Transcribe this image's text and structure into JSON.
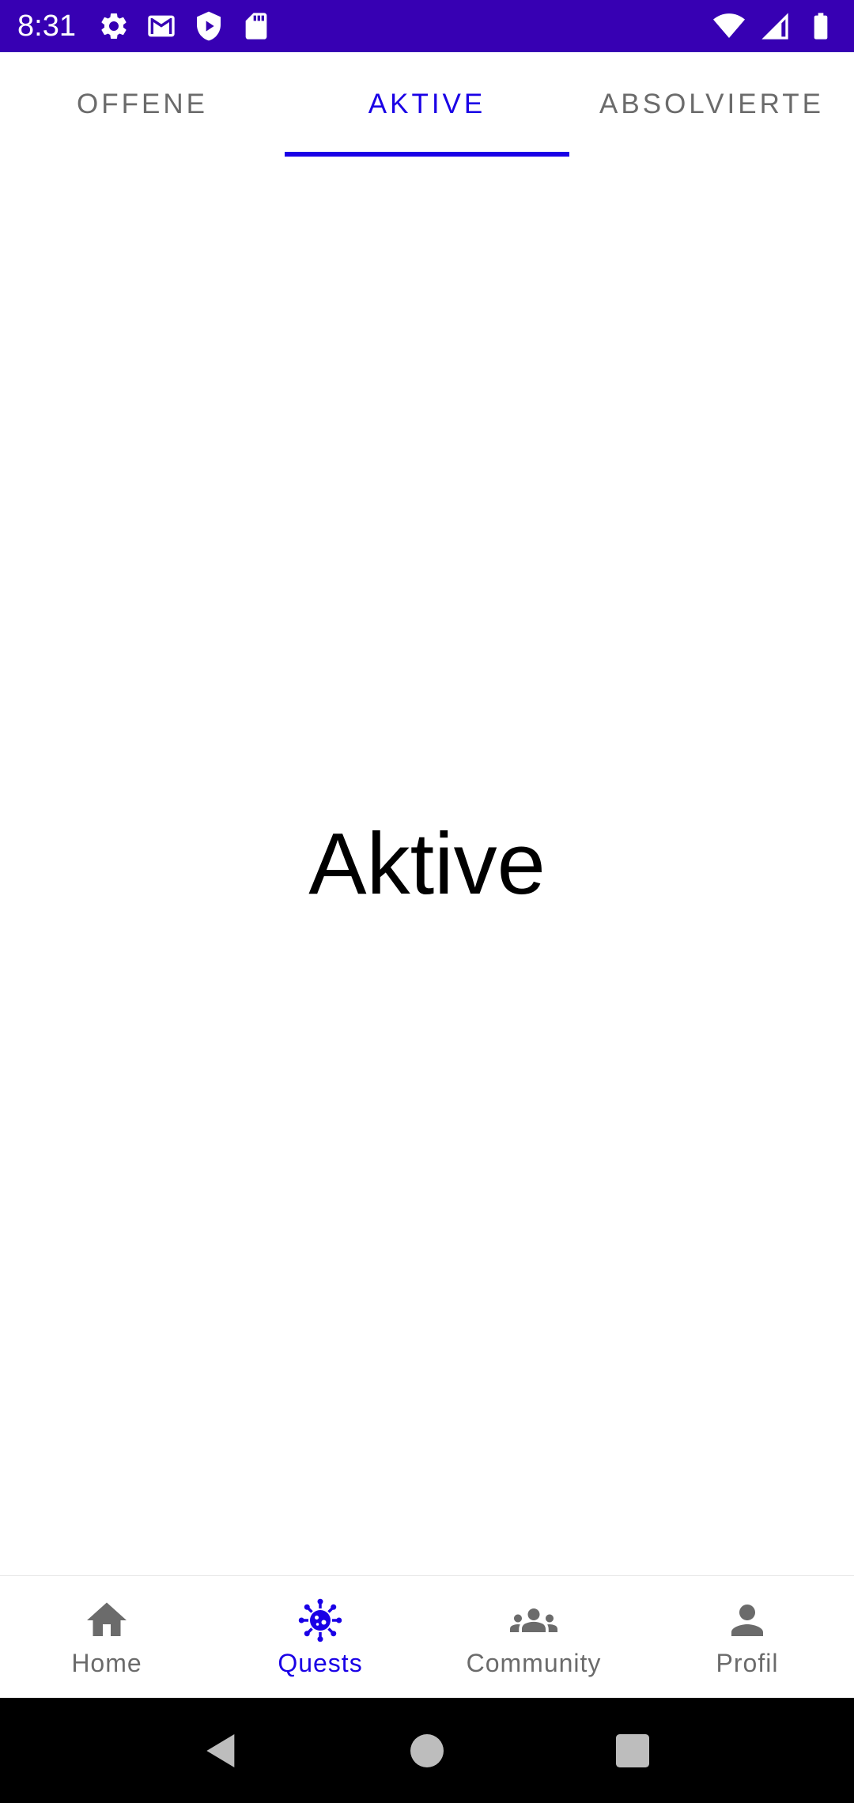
{
  "status_bar": {
    "time": "8:31",
    "left_icons": [
      "settings-icon",
      "gmail-icon",
      "shield-play-icon",
      "sd-card-icon"
    ],
    "right_icons": [
      "wifi-icon",
      "signal-icon",
      "battery-icon"
    ],
    "background": "#3700b3"
  },
  "tabs": [
    {
      "label": "OFFENE",
      "active": false
    },
    {
      "label": "AKTIVE",
      "active": true
    },
    {
      "label": "ABSOLVIERTE",
      "active": false
    }
  ],
  "main": {
    "title": "Aktive"
  },
  "bottom_nav": [
    {
      "label": "Home",
      "icon": "home-icon",
      "active": false
    },
    {
      "label": "Quests",
      "icon": "virus-icon",
      "active": true
    },
    {
      "label": "Community",
      "icon": "groups-icon",
      "active": false
    },
    {
      "label": "Profil",
      "icon": "person-icon",
      "active": false
    }
  ],
  "colors": {
    "accent": "#1a00e6",
    "inactive": "#6b6b6b",
    "status_bar": "#3700b3"
  }
}
